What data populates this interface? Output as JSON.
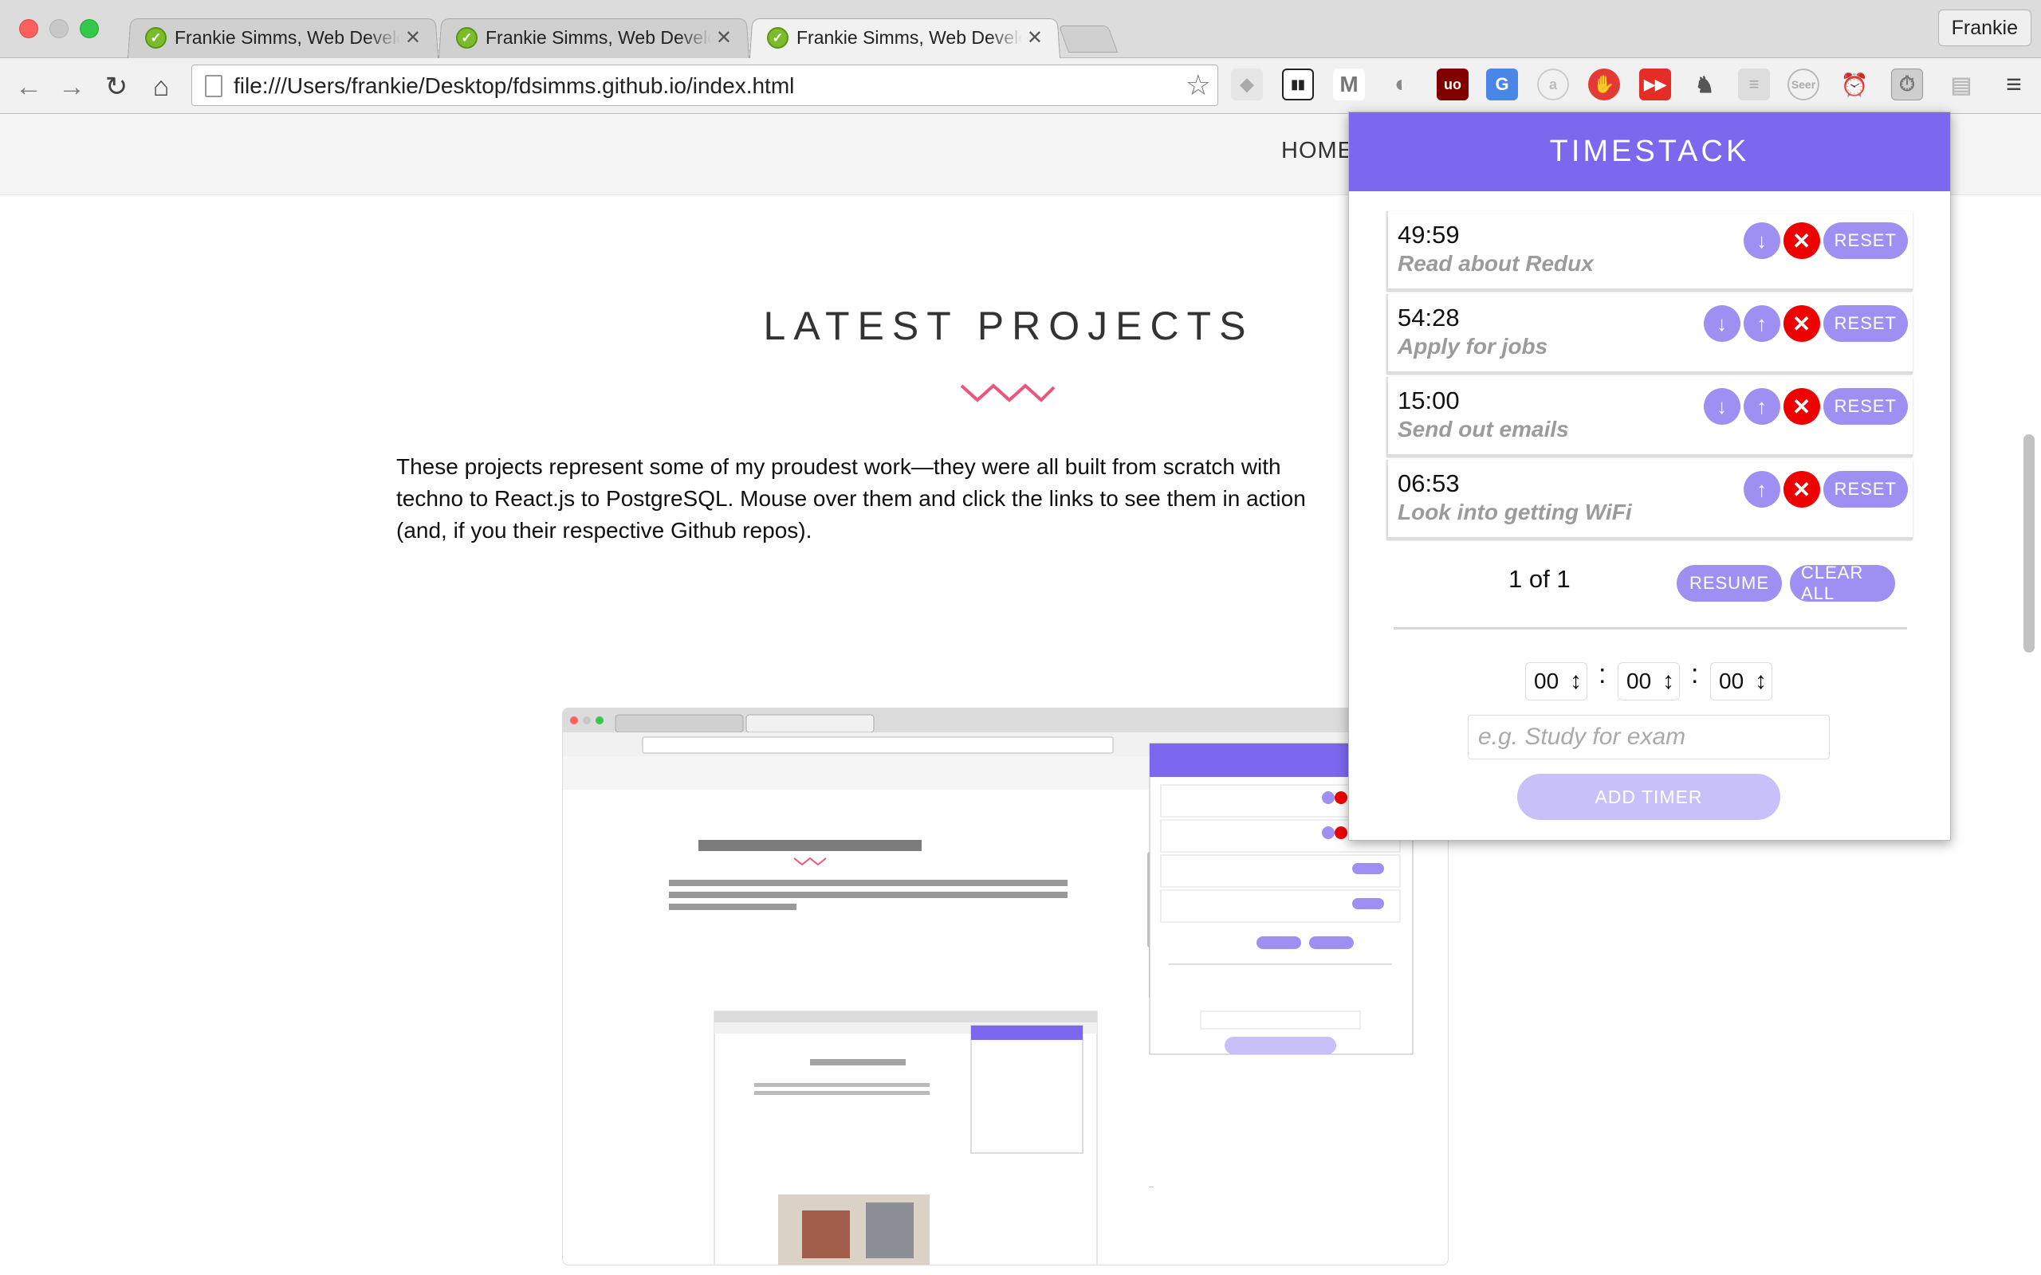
{
  "browser": {
    "tabs": [
      {
        "title": "Frankie Simms, Web Developer",
        "active": false
      },
      {
        "title": "Frankie Simms, Web Developer",
        "active": false
      },
      {
        "title": "Frankie Simms, Web Developer",
        "active": true
      }
    ],
    "profile_name": "Frankie",
    "url": "file:///Users/frankie/Desktop/fdsimms.github.io/index.html",
    "extensions": [
      "cube-icon",
      "piano-icon",
      "gmail-icon",
      "moon-icon",
      "ublock-icon",
      "translate-icon",
      "amazon-icon",
      "hand-icon",
      "youtube-icon",
      "evernote-icon",
      "stack-icon",
      "seer-icon",
      "alarm-icon",
      "timestack-icon",
      "reader-icon"
    ]
  },
  "page": {
    "nav_home": "HOME",
    "section_title": "LATEST PROJECTS",
    "intro": "These projects represent some of my proudest work—they were all built from scratch with techno to React.js to PostgreSQL. Mouse over them and click the links to see them in action (and, if you their respective Github repos).",
    "accent_color": "#e8587a"
  },
  "popup": {
    "title": "TIMESTACK",
    "header_color": "#7b68ee",
    "timers": [
      {
        "time": "49:59",
        "label": "Read about Redux",
        "buttons": [
          "down"
        ]
      },
      {
        "time": "54:28",
        "label": "Apply for jobs",
        "buttons": [
          "down",
          "up"
        ]
      },
      {
        "time": "15:00",
        "label": "Send out emails",
        "buttons": [
          "down",
          "up"
        ]
      },
      {
        "time": "06:53",
        "label": "Look into getting WiFi",
        "buttons": [
          "up"
        ]
      }
    ],
    "reset_label": "RESET",
    "pager": "1 of 1",
    "resume_label": "RESUME",
    "clear_all_label": "CLEAR ALL",
    "hours": "00",
    "minutes": "00",
    "seconds": "00",
    "name_placeholder": "e.g. Study for exam",
    "add_timer_label": "ADD TIMER"
  }
}
